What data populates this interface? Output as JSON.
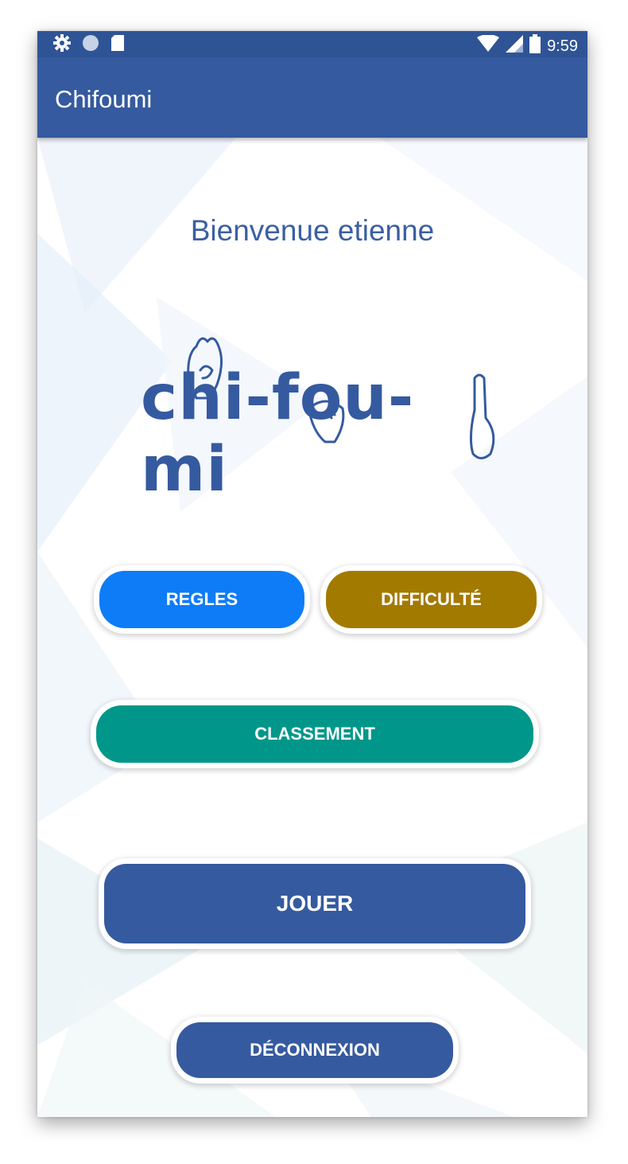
{
  "statusbar": {
    "time": "9:59",
    "left_icons": [
      "settings-icon",
      "circle-icon",
      "sd-card-icon"
    ],
    "right_icons": [
      "wifi-icon",
      "signal-icon",
      "battery-icon"
    ]
  },
  "appbar": {
    "title": "Chifoumi"
  },
  "main": {
    "welcome": "Bienvenue etienne",
    "logo_text": "chi-fou-mi",
    "buttons": {
      "regles": "REGLES",
      "difficulte": "DIFFICULTÉ",
      "classement": "CLASSEMENT",
      "jouer": "JOUER",
      "deconnexion": "DÉCONNEXION"
    }
  },
  "colors": {
    "primary": "#355a9f",
    "statusbar": "#2f5496",
    "regles": "#0e7cf7",
    "difficulte": "#a37a00",
    "classement": "#00978a"
  }
}
